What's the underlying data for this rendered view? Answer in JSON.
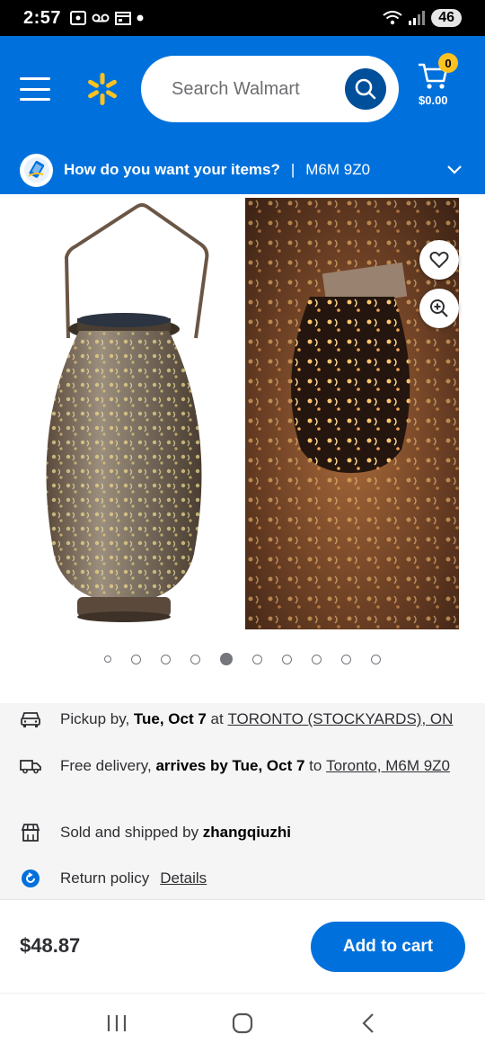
{
  "status_bar": {
    "time": "2:57",
    "battery": "46",
    "left_icons": [
      "screenshot-icon",
      "voicemail-icon",
      "calendar-icon",
      "dot-icon"
    ],
    "right_icons": [
      "wifi-icon",
      "signal-icon"
    ]
  },
  "header": {
    "search_placeholder": "Search Walmart",
    "cart_count": "0",
    "cart_total": "$0.00",
    "delivery_question": "How do you want your items?",
    "delivery_separator": "|",
    "postal_code": "M6M 9Z0"
  },
  "gallery": {
    "dot_count": 10,
    "active_index": 4
  },
  "fulfillment": {
    "pickup_prefix": "Pickup by, ",
    "pickup_date": "Tue, Oct 7",
    "pickup_at": " at ",
    "pickup_store": "TORONTO (STOCKYARDS), ON",
    "delivery_prefix": "Free delivery, ",
    "delivery_date": "arrives by Tue, Oct 7",
    "delivery_to": " to ",
    "delivery_location": "Toronto, M6M 9Z0",
    "seller_prefix": "Sold and shipped by ",
    "seller_name": "zhangqiuzhi",
    "return_label": "Return policy",
    "return_link": "Details"
  },
  "action_bar": {
    "price": "$48.87",
    "add_to_cart": "Add to cart"
  },
  "colors": {
    "brand_blue": "#0071dc",
    "brand_yellow": "#ffc220",
    "dark_blue": "#004f9a"
  }
}
